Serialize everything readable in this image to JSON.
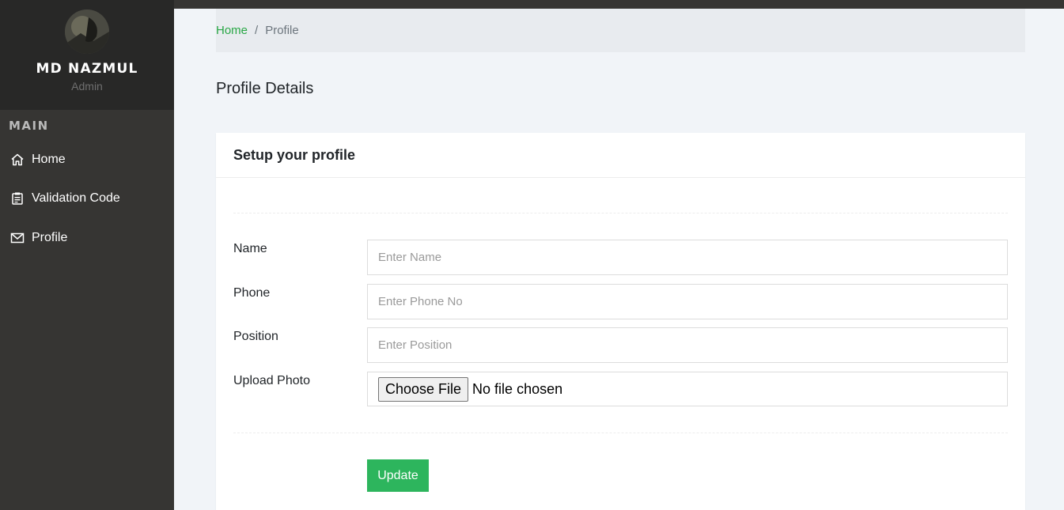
{
  "sidebar": {
    "user": {
      "name": "MD NAZMUL",
      "role": "Admin"
    },
    "section_title": "MAIN",
    "items": [
      {
        "label": "Home",
        "icon": "home-icon"
      },
      {
        "label": "Validation Code",
        "icon": "clipboard-icon"
      },
      {
        "label": "Profile",
        "icon": "envelope-icon"
      }
    ]
  },
  "breadcrumb": {
    "home": "Home",
    "separator": "/",
    "current": "Profile"
  },
  "page": {
    "title": "Profile Details"
  },
  "card": {
    "title": "Setup your profile",
    "fields": {
      "name": {
        "label": "Name",
        "placeholder": "Enter Name",
        "value": ""
      },
      "phone": {
        "label": "Phone",
        "placeholder": "Enter Phone No",
        "value": ""
      },
      "position": {
        "label": "Position",
        "placeholder": "Enter Position",
        "value": ""
      },
      "photo": {
        "label": "Upload Photo",
        "button": "Choose File",
        "status": "No file chosen"
      }
    },
    "submit_label": "Update"
  },
  "colors": {
    "accent": "#2db55d",
    "sidebar": "#363533",
    "link": "#28a745"
  }
}
